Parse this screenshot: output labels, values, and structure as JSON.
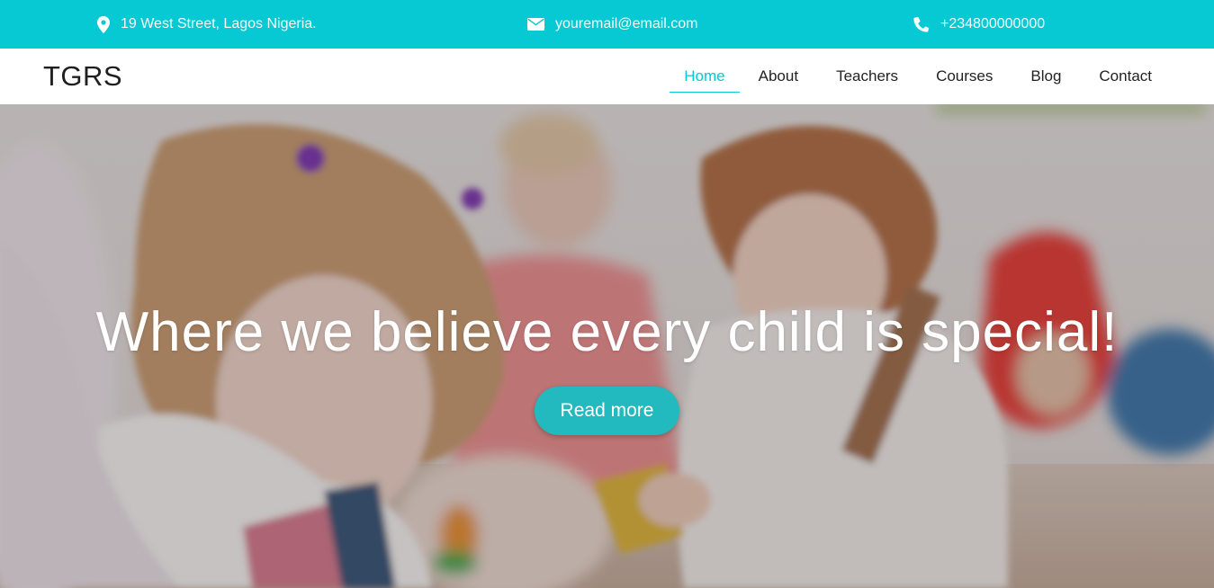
{
  "topbar": {
    "address": "19 West Street, Lagos Nigeria.",
    "email": "youremail@email.com",
    "phone": "+234800000000",
    "background": "#06c9d3",
    "icons": [
      "map-marker-icon",
      "envelope-icon",
      "phone-icon"
    ]
  },
  "navbar": {
    "brand": "TGRS",
    "items": [
      {
        "label": "Home",
        "active": true
      },
      {
        "label": "About",
        "active": false
      },
      {
        "label": "Teachers",
        "active": false
      },
      {
        "label": "Courses",
        "active": false
      },
      {
        "label": "Blog",
        "active": false
      },
      {
        "label": "Contact",
        "active": false
      }
    ],
    "accent": "#06c9d3"
  },
  "hero": {
    "heading": "Where we believe every child is special!",
    "button_label": "Read more",
    "button_color": "#22b9bf"
  }
}
